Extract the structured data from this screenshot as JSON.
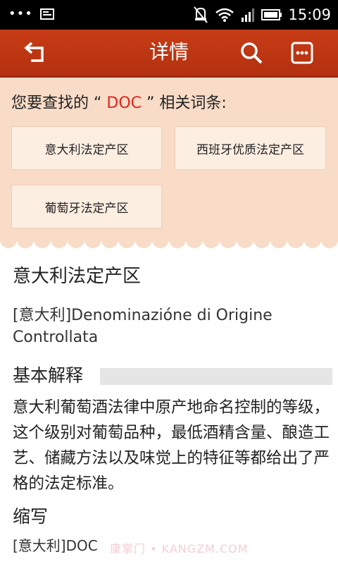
{
  "status_bar": {
    "time": "15:09",
    "icons": [
      "more-dots-icon",
      "screenshot-icon",
      "vibrate-off-icon",
      "wifi-icon",
      "signal-icon",
      "battery-icon"
    ]
  },
  "app_bar": {
    "title": "详情",
    "color": "#c0360f",
    "icons": [
      "back-icon",
      "search-icon",
      "more-icon"
    ]
  },
  "related": {
    "prefix": "您要查找的 “ ",
    "keyword": "DOC",
    "suffix": " ” 相关词条:",
    "items": [
      "意大利法定产区",
      "西班牙优质法定产区",
      "葡萄牙法定产区"
    ]
  },
  "entry": {
    "title": "意大利法定产区",
    "original": "[意大利]Denominazióne di Origine Controllata",
    "sections": [
      {
        "title": "基本解释",
        "text": "意大利葡萄酒法律中原产地命名控制的等级，这个级别对葡萄品种，最低酒精含量、酿造工艺、储藏方法以及味觉上的特征等都给出了严格的法定标准。"
      },
      {
        "title": "缩写",
        "text": "[意大利]DOC"
      }
    ]
  },
  "watermark": "康掌门 • KANGZM.COM",
  "colors": {
    "accent": "#c0360f",
    "keyword": "#e0241b",
    "panel": "#f8dcc7",
    "chip": "#fdeee2"
  }
}
